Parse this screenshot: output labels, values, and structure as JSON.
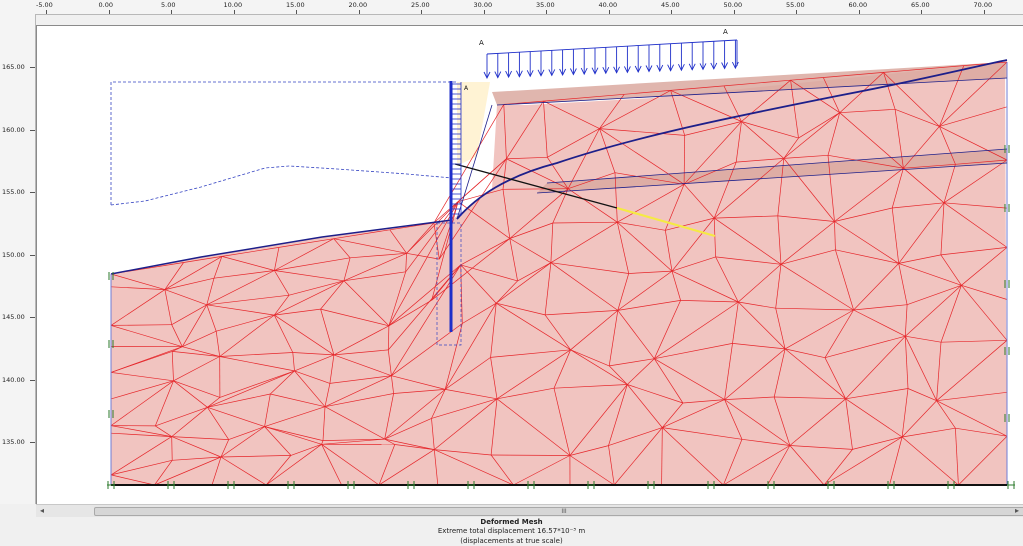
{
  "rulers": {
    "x_labels": [
      "-5.00",
      "0.00",
      "5.00",
      "10.00",
      "15.00",
      "20.00",
      "25.00",
      "30.00",
      "35.00",
      "40.00",
      "45.00",
      "50.00",
      "55.00",
      "60.00",
      "65.00",
      "70.00"
    ],
    "y_labels": [
      "165.00",
      "160.00",
      "155.00",
      "150.00",
      "145.00",
      "140.00",
      "135.00"
    ]
  },
  "model": {
    "load_label_a1": "A",
    "load_label_a2": "A",
    "wall_label": "A"
  },
  "scrollbar": {
    "left_arrow": "◂",
    "right_arrow": "▸",
    "thumb_grip": "III"
  },
  "caption": {
    "title": "Deformed Mesh",
    "extreme_displacement": "Extreme total displacement 16.57*10⁻³ m",
    "scale_note": "(displacements at true scale)"
  },
  "colors": {
    "mesh_fill": "#f1c4c0",
    "mesh_line": "#e5262a",
    "wall": "#1f2fc9",
    "layer_fill": "#dba9a0",
    "anchor_grout": "#f5ea43",
    "phreatic_dashed": "#3544c2",
    "crack_line": "#1d1f8a"
  }
}
